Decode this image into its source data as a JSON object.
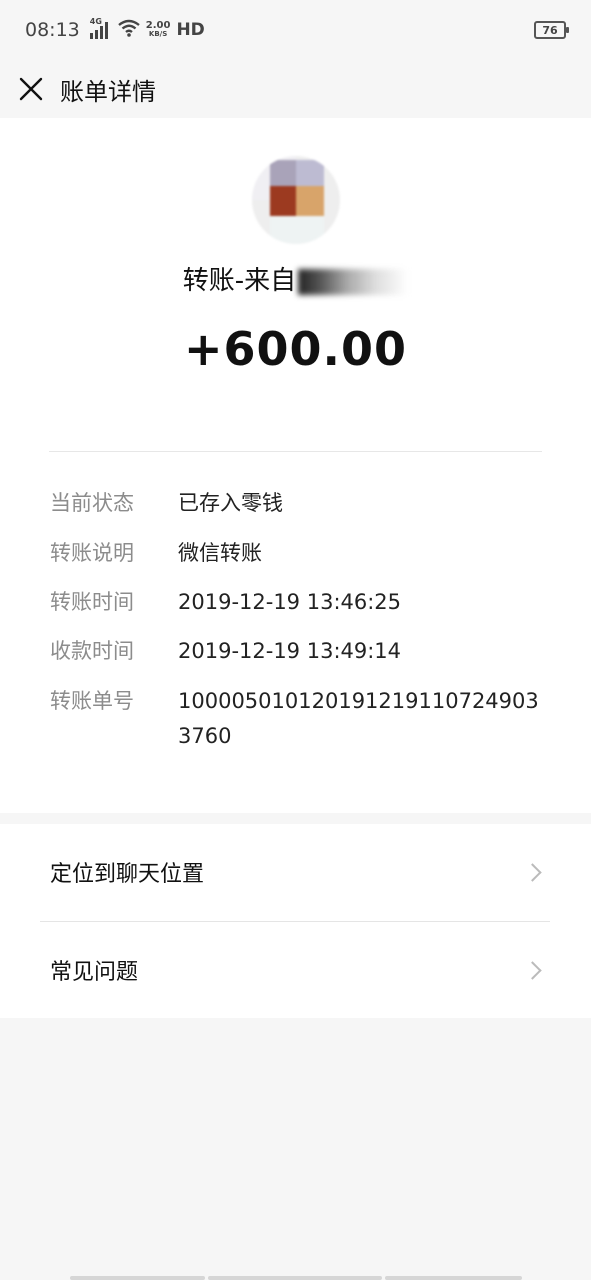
{
  "status_bar": {
    "time": "08:13",
    "network": "4G",
    "speed_value": "2.00",
    "speed_unit": "KB/S",
    "hd": "HD",
    "battery": "76"
  },
  "nav": {
    "title": "账单详情",
    "close_icon": "close-icon"
  },
  "summary": {
    "title_prefix": "转账-来自",
    "amount": "+600.00"
  },
  "details": [
    {
      "label": "当前状态",
      "value": "已存入零钱"
    },
    {
      "label": "转账说明",
      "value": "微信转账"
    },
    {
      "label": "转账时间",
      "value": "2019-12-19 13:46:25"
    },
    {
      "label": "收款时间",
      "value": "2019-12-19 13:49:14"
    },
    {
      "label": "转账单号",
      "value": "1000050101201912191107249033760"
    }
  ],
  "menu": [
    {
      "label": "定位到聊天位置",
      "icon": "chevron-right-icon"
    },
    {
      "label": "常见问题",
      "icon": "chevron-right-icon"
    }
  ],
  "colors": {
    "background": "#f6f6f6",
    "card": "#ffffff",
    "label_gray": "#8c8c8c",
    "divider": "#e7e7e7"
  }
}
